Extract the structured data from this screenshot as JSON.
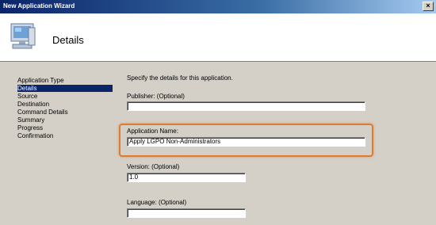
{
  "window": {
    "title": "New Application Wizard"
  },
  "header": {
    "title": "Details",
    "icon": "computer-icon"
  },
  "nav": {
    "items": [
      {
        "label": "Application Type",
        "selected": false
      },
      {
        "label": "Details",
        "selected": true
      },
      {
        "label": "Source",
        "selected": false
      },
      {
        "label": "Destination",
        "selected": false
      },
      {
        "label": "Command Details",
        "selected": false
      },
      {
        "label": "Summary",
        "selected": false
      },
      {
        "label": "Progress",
        "selected": false
      },
      {
        "label": "Confirmation",
        "selected": false
      }
    ]
  },
  "main": {
    "description": "Specify the details for this application.",
    "publisher": {
      "label": "Publisher: (Optional)",
      "value": ""
    },
    "application_name": {
      "label": "Application Name:",
      "value": "Apply LGPO Non-Administrators"
    },
    "version": {
      "label": "Version: (Optional)",
      "value": "1.0"
    },
    "language": {
      "label": "Language: (Optional)",
      "value": ""
    }
  },
  "colors": {
    "titlebar": "#0a246a",
    "selection": "#0a246a",
    "highlight": "#e07a2e"
  }
}
